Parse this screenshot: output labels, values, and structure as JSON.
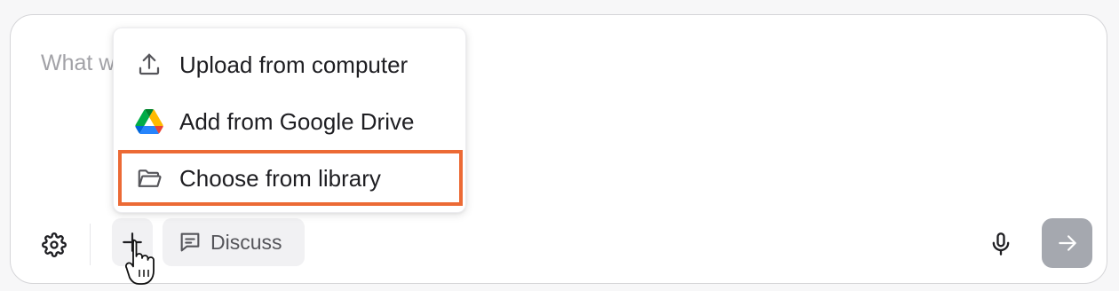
{
  "composer": {
    "placeholder": "What w"
  },
  "toolbar": {
    "settings_icon": "gear-icon",
    "plus_icon": "plus-icon",
    "discuss_label": "Discuss",
    "discuss_icon": "chat-bubble-icon",
    "mic_icon": "microphone-icon",
    "send_icon": "arrow-right-icon"
  },
  "attach_menu": {
    "items": [
      {
        "label": "Upload from computer",
        "icon": "upload-icon"
      },
      {
        "label": "Add from Google Drive",
        "icon": "google-drive-icon"
      },
      {
        "label": "Choose from library",
        "icon": "folder-open-icon"
      }
    ],
    "highlighted_item": "Choose from library"
  },
  "colors": {
    "highlight": "#ec6a35",
    "send_button": "#a5a8af",
    "toolbar_button_bg": "#f1f1f3",
    "placeholder_text": "#a2a2a7"
  }
}
